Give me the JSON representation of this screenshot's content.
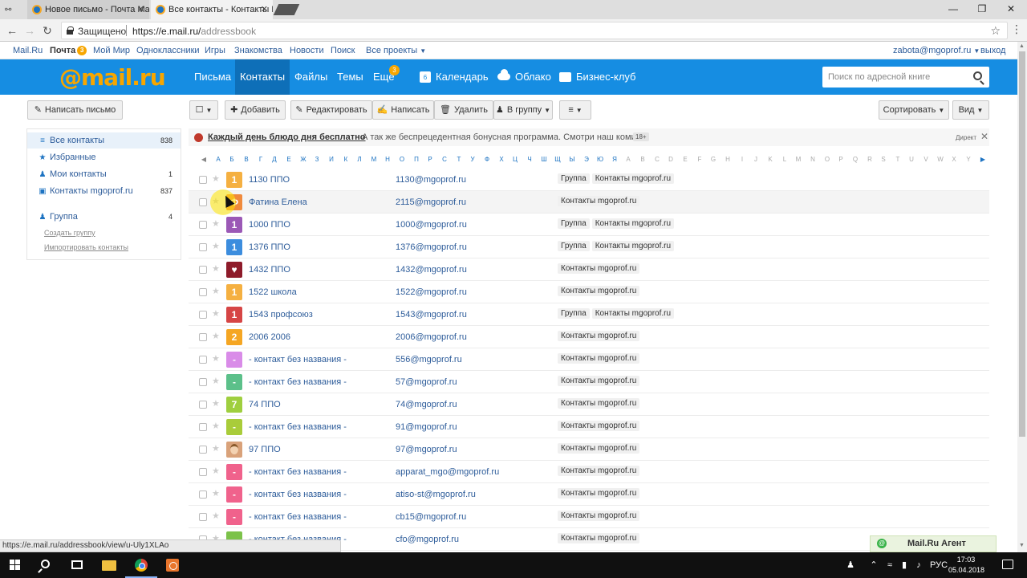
{
  "browser": {
    "tabs": [
      {
        "title": "Новое письмо - Почта Mail.Ru"
      },
      {
        "title": "Все контакты - Контакты Mail.Ru"
      }
    ],
    "security_label": "Защищено",
    "url_base": "https://e.mail.ru/",
    "url_path": "addressbook"
  },
  "portal": {
    "links": [
      "Mail.Ru",
      "Почта",
      "Мой Мир",
      "Одноклассники",
      "Игры",
      "Знакомства",
      "Новости",
      "Поиск",
      "Все проекты"
    ],
    "mail_badge": "3",
    "user": "zabota@mgoprof.ru",
    "logout": "выход"
  },
  "header": {
    "logo": "@mail.ru",
    "nav": [
      "Письма",
      "Контакты",
      "Файлы",
      "Темы",
      "Ещё"
    ],
    "more_badge": "3",
    "calendar_day": "6",
    "calendar": "Календарь",
    "cloud": "Облако",
    "business": "Бизнес-клуб",
    "search_placeholder": "Поиск по адресной книге"
  },
  "toolbar": {
    "compose": "Написать письмо",
    "add": "Добавить",
    "edit": "Редактировать",
    "write": "Написать",
    "delete": "Удалить",
    "to_group": "В группу",
    "sort": "Сортировать",
    "view": "Вид"
  },
  "sidebar": {
    "items": [
      {
        "label": "Все контакты",
        "count": "838"
      },
      {
        "label": "Избранные",
        "count": ""
      },
      {
        "label": "Мои контакты",
        "count": "1"
      },
      {
        "label": "Контакты mgoprof.ru",
        "count": "837"
      },
      {
        "label": "Группа",
        "count": "4"
      }
    ],
    "create_group": "Создать группу",
    "import_contacts": "Импортировать контакты"
  },
  "promo": {
    "title": "Каждый день блюдо дня бесплатно",
    "text": "А так же беспрецедентная бонусная программа. Смотри наш комикс.",
    "age": "18+",
    "direct": "Директ"
  },
  "alphabet": {
    "ru": [
      "А",
      "Б",
      "В",
      "Г",
      "Д",
      "Е",
      "Ж",
      "З",
      "И",
      "К",
      "Л",
      "М",
      "Н",
      "О",
      "П",
      "Р",
      "С",
      "Т",
      "У",
      "Ф",
      "Х",
      "Ц",
      "Ч",
      "Ш",
      "Щ",
      "Ы",
      "Э",
      "Ю",
      "Я"
    ],
    "en": [
      "A",
      "B",
      "C",
      "D",
      "E",
      "F",
      "G",
      "H",
      "I",
      "J",
      "K",
      "L",
      "M",
      "N",
      "O",
      "P",
      "Q",
      "R",
      "S",
      "T",
      "U",
      "V",
      "W",
      "X",
      "Y"
    ]
  },
  "contacts": [
    {
      "avatar": "1",
      "color": "#f5b041",
      "name": "1130 ППО",
      "email": "1130@mgoprof.ru",
      "tags": [
        "Группа",
        "Контакты mgoprof.ru"
      ]
    },
    {
      "avatar": "Ф",
      "color": "#f08a3c",
      "name": "Фатина Елена",
      "email": "2115@mgoprof.ru",
      "tags": [
        "Контакты mgoprof.ru"
      ]
    },
    {
      "avatar": "1",
      "color": "#9b59b6",
      "name": "1000 ППО",
      "email": "1000@mgoprof.ru",
      "tags": [
        "Группа",
        "Контакты mgoprof.ru"
      ]
    },
    {
      "avatar": "1",
      "color": "#3c8dde",
      "name": "1376 ППО",
      "email": "1376@mgoprof.ru",
      "tags": [
        "Группа",
        "Контакты mgoprof.ru"
      ]
    },
    {
      "avatar": "",
      "color": "#8e1b2a",
      "pic": "heart",
      "name": "1432 ППО",
      "email": "1432@mgoprof.ru",
      "tags": [
        "Контакты mgoprof.ru"
      ]
    },
    {
      "avatar": "1",
      "color": "#f5b041",
      "name": "1522 школа",
      "email": "1522@mgoprof.ru",
      "tags": [
        "Контакты mgoprof.ru"
      ]
    },
    {
      "avatar": "1",
      "color": "#d64545",
      "name": "1543 профсоюз",
      "email": "1543@mgoprof.ru",
      "tags": [
        "Группа",
        "Контакты mgoprof.ru"
      ]
    },
    {
      "avatar": "2",
      "color": "#f5a623",
      "name": "2006 2006",
      "email": "2006@mgoprof.ru",
      "tags": [
        "Контакты mgoprof.ru"
      ]
    },
    {
      "avatar": "-",
      "color": "#d98ce8",
      "name": "- контакт без названия -",
      "email": "556@mgoprof.ru",
      "tags": [
        "Контакты mgoprof.ru"
      ]
    },
    {
      "avatar": "-",
      "color": "#5cc08a",
      "name": "- контакт без названия -",
      "email": "57@mgoprof.ru",
      "tags": [
        "Контакты mgoprof.ru"
      ]
    },
    {
      "avatar": "7",
      "color": "#9fcf3f",
      "name": "74 ППО",
      "email": "74@mgoprof.ru",
      "tags": [
        "Контакты mgoprof.ru"
      ]
    },
    {
      "avatar": "-",
      "color": "#a9cc3a",
      "name": "- контакт без названия -",
      "email": "91@mgoprof.ru",
      "tags": [
        "Контакты mgoprof.ru"
      ]
    },
    {
      "avatar": "",
      "color": "#d9a27a",
      "pic": "photo",
      "name": "97 ППО",
      "email": "97@mgoprof.ru",
      "tags": [
        "Контакты mgoprof.ru"
      ]
    },
    {
      "avatar": "-",
      "color": "#f0628c",
      "name": "- контакт без названия -",
      "email": "apparat_mgo@mgoprof.ru",
      "tags": [
        "Контакты mgoprof.ru"
      ]
    },
    {
      "avatar": "-",
      "color": "#f0628c",
      "name": "- контакт без названия -",
      "email": "atiso-st@mgoprof.ru",
      "tags": [
        "Контакты mgoprof.ru"
      ]
    },
    {
      "avatar": "-",
      "color": "#f0628c",
      "name": "- контакт без названия -",
      "email": "cb15@mgoprof.ru",
      "tags": [
        "Контакты mgoprof.ru"
      ]
    },
    {
      "avatar": "-",
      "color": "#7cc24a",
      "name": "- контакт без названия -",
      "email": "cfo@mgoprof.ru",
      "tags": [
        "Контакты mgoprof.ru"
      ]
    }
  ],
  "status_url": "https://e.mail.ru/addressbook/view/u-Uly1XLAo",
  "agent": "Mail.Ru Агент",
  "taskbar": {
    "lang": "РУС",
    "time": "17:03",
    "date": "05.04.2018"
  },
  "colors": {
    "header_blue": "#168de2",
    "logo_orange": "#f7a600",
    "link_blue": "#2d5c9a"
  }
}
